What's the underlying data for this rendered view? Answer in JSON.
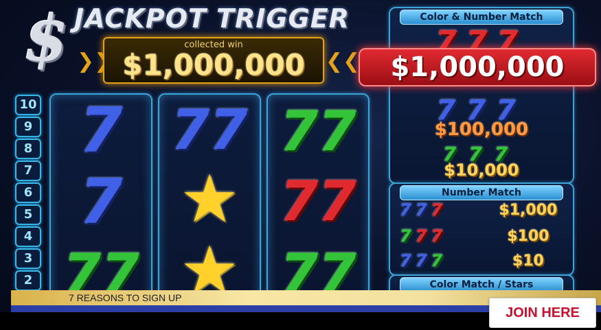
{
  "game": {
    "logo_symbol": "$",
    "title": "JACKPOT TRIGGER",
    "collected_label": "collected win",
    "collected_value": "$1,000,000"
  },
  "rows": [
    "10",
    "9",
    "8",
    "7",
    "6",
    "5",
    "4",
    "3",
    "2"
  ],
  "reels": [
    {
      "symbols": [
        {
          "type": "seven",
          "color": "blue",
          "text": "7"
        },
        {
          "type": "seven",
          "color": "blue",
          "text": "7"
        },
        {
          "type": "seven",
          "color": "green",
          "text": "77"
        }
      ]
    },
    {
      "symbols": [
        {
          "type": "seven",
          "color": "blue",
          "text": "77"
        },
        {
          "type": "star",
          "color": "gold",
          "text": "★"
        },
        {
          "type": "star",
          "color": "gold",
          "text": "★"
        }
      ]
    },
    {
      "symbols": [
        {
          "type": "seven",
          "color": "green",
          "text": "77"
        },
        {
          "type": "seven",
          "color": "red",
          "text": "77"
        },
        {
          "type": "seven",
          "color": "green",
          "text": "77"
        }
      ]
    }
  ],
  "paytable": {
    "color_number_header": "Color & Number Match",
    "jackpot_sevens": "777",
    "jackpot_value": "$1,000,000",
    "tier2_sevens": "777",
    "tier2_value": "$100,000",
    "tier3_sevens": "777",
    "tier3_value": "$10,000",
    "number_match_header": "Number Match",
    "nm_rows": [
      {
        "sevens": "777",
        "value": "$1,000"
      },
      {
        "sevens": "777",
        "value": "$100"
      },
      {
        "sevens": "777",
        "value": "$10"
      }
    ],
    "color_match_header": "Color Match / Stars"
  },
  "footer": {
    "signup_text": "7 REASONS TO SIGN UP",
    "join_label": "JOIN HERE"
  },
  "colors": {
    "blue_seven": "#4060e8",
    "green_seven": "#34c43a",
    "red_seven": "#e02a30",
    "star_gold": "#ffd12a",
    "frame_cyan": "#3da4d8",
    "join_text": "#c8102e"
  }
}
